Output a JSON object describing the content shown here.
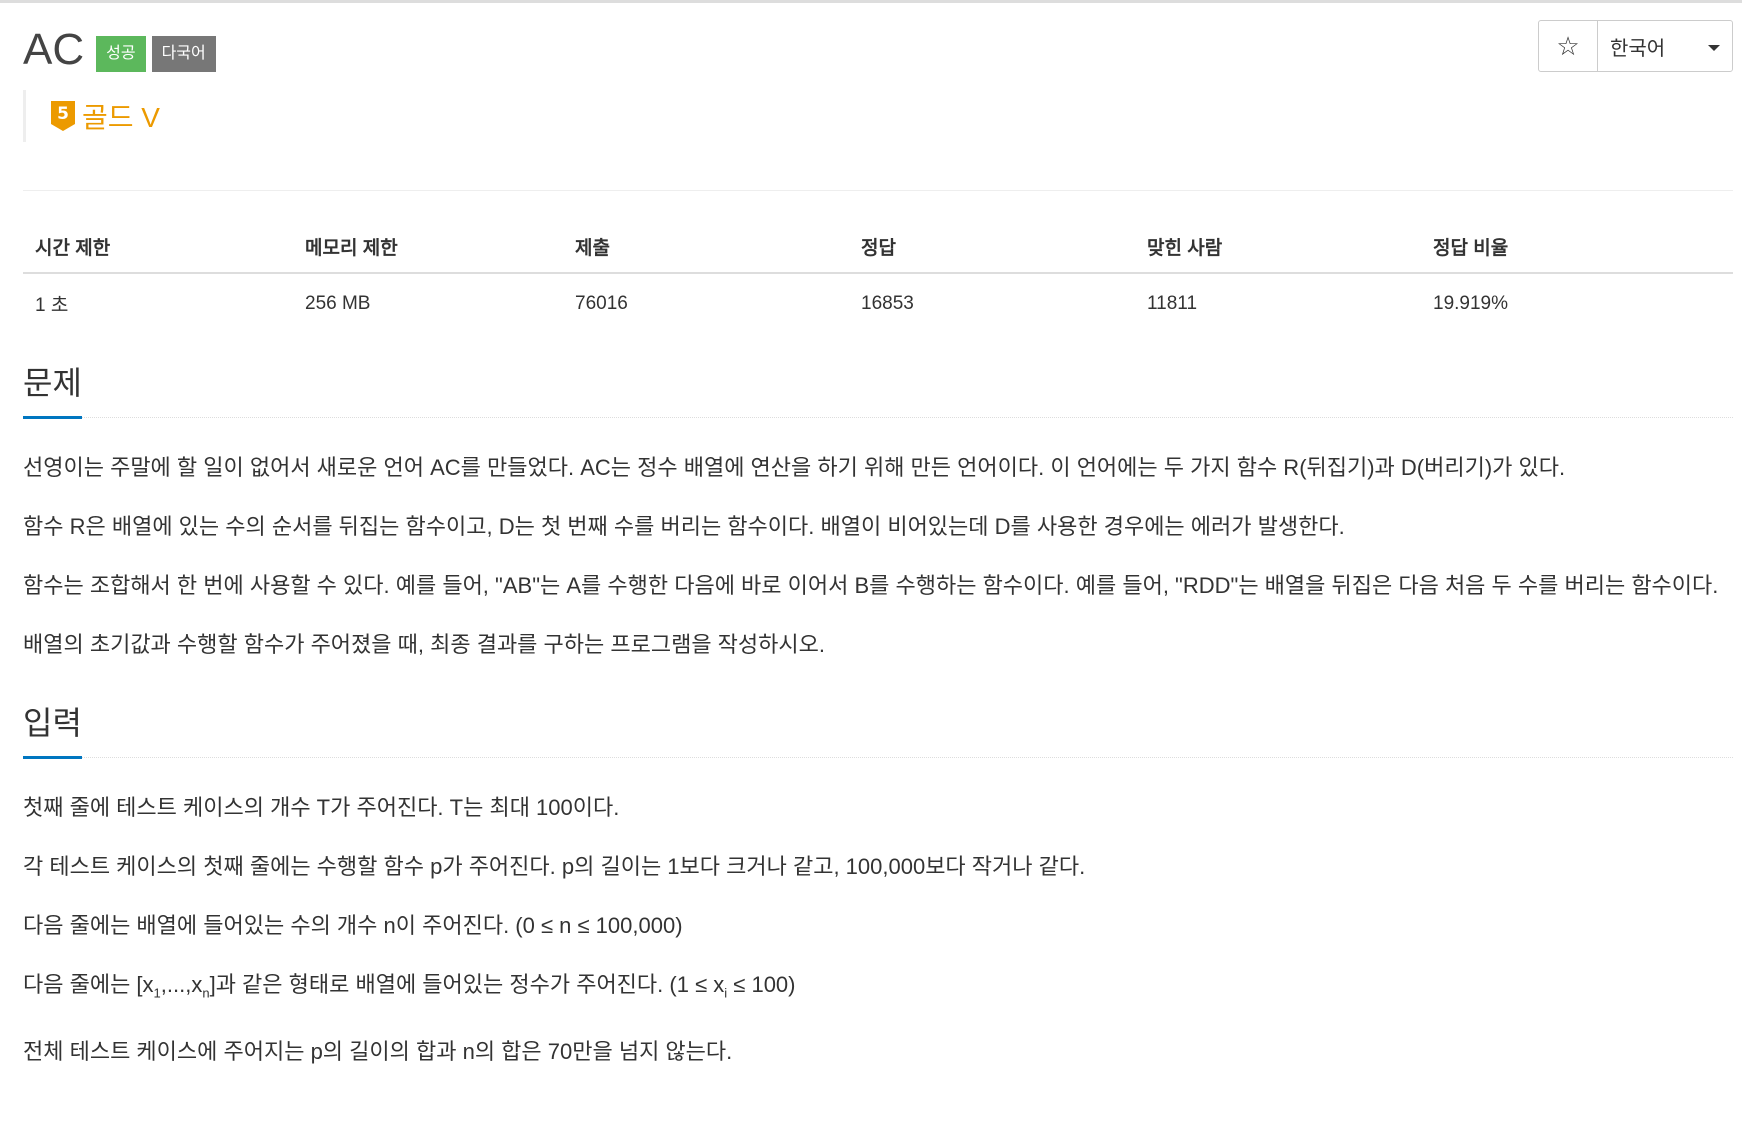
{
  "problem": {
    "title": "AC",
    "labels": [
      "성공",
      "다국어"
    ],
    "tier": "골드 V",
    "tier_number": "5",
    "tier_color": "#ec9a00"
  },
  "header_controls": {
    "star_icon": "star-outline-icon",
    "star_glyph": "☆",
    "language": "한국어"
  },
  "info_table": {
    "headers": [
      "시간 제한",
      "메모리 제한",
      "제출",
      "정답",
      "맞힌 사람",
      "정답 비율"
    ],
    "values": [
      "1 초",
      "256 MB",
      "76016",
      "16853",
      "11811",
      "19.919%"
    ]
  },
  "sections": {
    "problem_heading": "문제",
    "problem_paragraphs": [
      "선영이는 주말에 할 일이 없어서 새로운 언어 AC를 만들었다. AC는 정수 배열에 연산을 하기 위해 만든 언어이다. 이 언어에는 두 가지 함수 R(뒤집기)과 D(버리기)가 있다.",
      "함수 R은 배열에 있는 수의 순서를 뒤집는 함수이고, D는 첫 번째 수를 버리는 함수이다. 배열이 비어있는데 D를 사용한 경우에는 에러가 발생한다.",
      "함수는 조합해서 한 번에 사용할 수 있다. 예를 들어, \"AB\"는 A를 수행한 다음에 바로 이어서 B를 수행하는 함수이다. 예를 들어, \"RDD\"는 배열을 뒤집은 다음 처음 두 수를 버리는 함수이다.",
      "배열의 초기값과 수행할 함수가 주어졌을 때, 최종 결과를 구하는 프로그램을 작성하시오."
    ],
    "input_heading": "입력",
    "input_paragraphs": [
      "첫째 줄에 테스트 케이스의 개수 T가 주어진다. T는 최대 100이다.",
      "각 테스트 케이스의 첫째 줄에는 수행할 함수 p가 주어진다. p의 길이는 1보다 크거나 같고, 100,000보다 작거나 같다.",
      "다음 줄에는 배열에 들어있는 수의 개수 n이 주어진다. (0 ≤ n ≤ 100,000)"
    ],
    "input_line4": {
      "prefix": "다음 줄에는 [x",
      "sub1": "1",
      "middle": ",...,x",
      "subn": "n",
      "after_bracket": "]과 같은 형태로 배열에 들어있는 정수가 주어진다. (1 ≤ x",
      "subi": "i",
      "suffix": " ≤ 100)"
    },
    "input_line5": "전체 테스트 케이스에 주어지는 p의 길이의 합과 n의 합은 70만을 넘지 않는다."
  }
}
